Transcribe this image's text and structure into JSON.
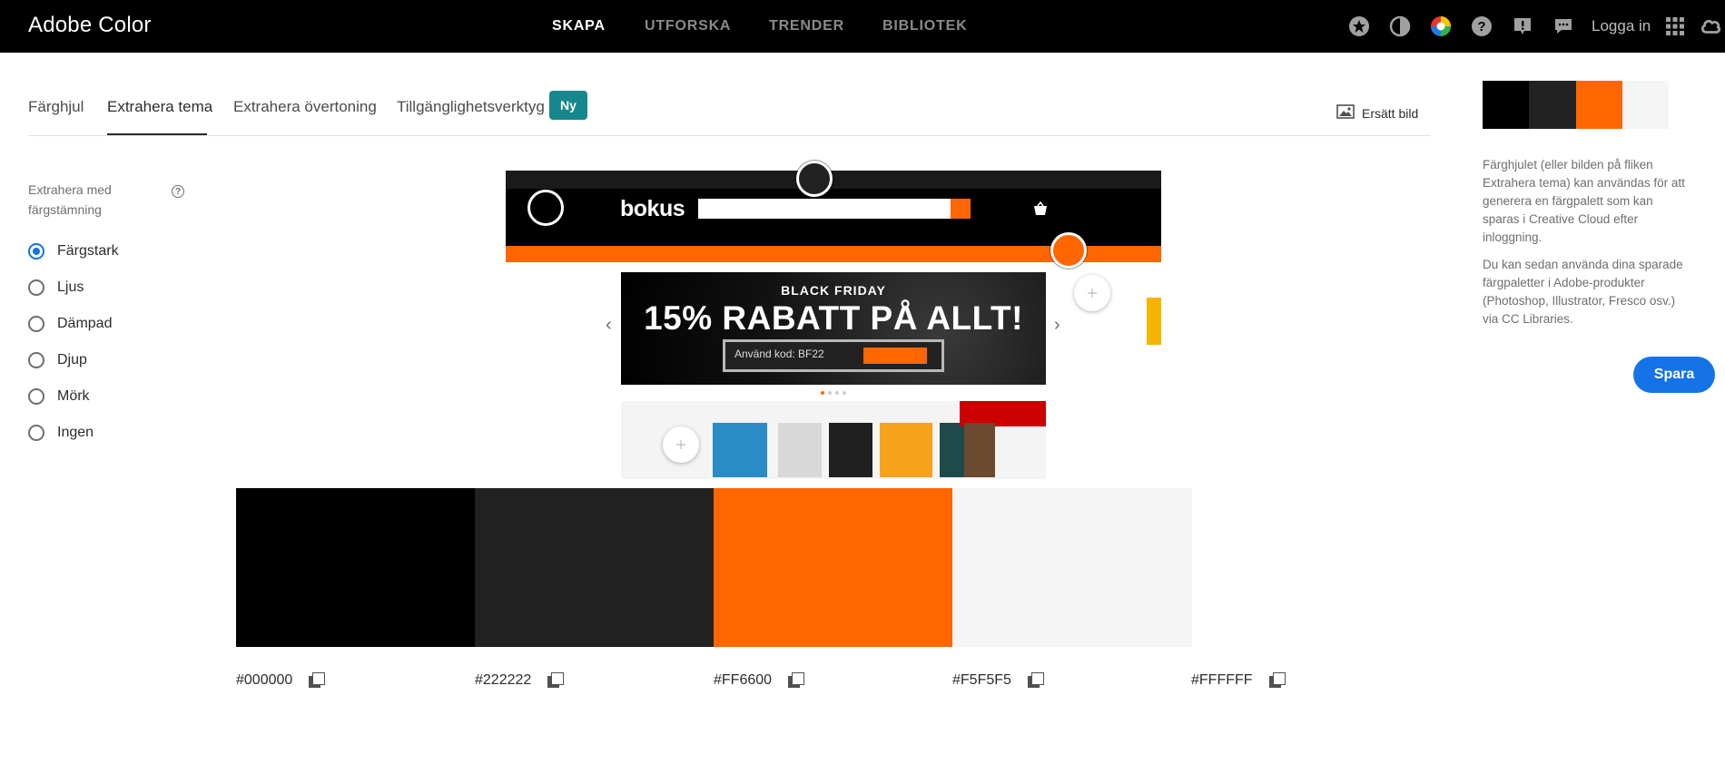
{
  "app": {
    "title": "Adobe Color",
    "nav": [
      {
        "label": "SKAPA",
        "active": true
      },
      {
        "label": "UTFORSKA",
        "active": false
      },
      {
        "label": "TRENDER",
        "active": false
      },
      {
        "label": "BIBLIOTEK",
        "active": false
      }
    ],
    "login_label": "Logga in",
    "icons": [
      "favorites-icon",
      "contrast-icon",
      "color-wheel-icon",
      "help-icon",
      "report-icon",
      "feedback-icon",
      "apps-grid-icon",
      "creative-cloud-icon"
    ]
  },
  "tabs": {
    "items": [
      {
        "label": "Färghjul",
        "active": false
      },
      {
        "label": "Extrahera tema",
        "active": true
      },
      {
        "label": "Extrahera övertoning",
        "active": false
      },
      {
        "label": "Tillgänglighetsverktyg",
        "active": false
      }
    ],
    "new_badge": "Ny",
    "replace_image_label": "Ersätt bild"
  },
  "mood": {
    "title": "Extrahera med färgstämning",
    "help_icon": "?",
    "options": [
      {
        "label": "Färgstark",
        "checked": true
      },
      {
        "label": "Ljus",
        "checked": false
      },
      {
        "label": "Dämpad",
        "checked": false
      },
      {
        "label": "Djup",
        "checked": false
      },
      {
        "label": "Mörk",
        "checked": false
      },
      {
        "label": "Ingen",
        "checked": false
      }
    ]
  },
  "preview": {
    "logo": "bokus",
    "banner_heading": "BLACK FRIDAY",
    "banner_big": "15% RABATT PÅ ALLT!",
    "code_text": "Använd kod: BF22",
    "slider_prev": "‹",
    "slider_next": "›"
  },
  "swatches": [
    {
      "hex": "#000000",
      "color": "#000000"
    },
    {
      "hex": "#222222",
      "color": "#222222"
    },
    {
      "hex": "#FF6600",
      "color": "#FF6600"
    },
    {
      "hex": "#F5F5F5",
      "color": "#F5F5F5"
    },
    {
      "hex": "#FFFFFF",
      "color": "#FFFFFF"
    }
  ],
  "right_panel": {
    "paragraph_1": "Färghjulet (eller bilden på fliken Extrahera tema) kan användas för att generera en färgpalett som kan sparas i Creative Cloud efter inloggning.",
    "paragraph_2": "Du kan sedan använda dina sparade färgpaletter i Adobe-produkter (Photoshop, Illustrator, Fresco osv.) via CC Libraries.",
    "save_label": "Spara"
  },
  "colors": {
    "accent": "#1473e6",
    "teal_badge": "#16878c",
    "orange": "#FF6600"
  }
}
